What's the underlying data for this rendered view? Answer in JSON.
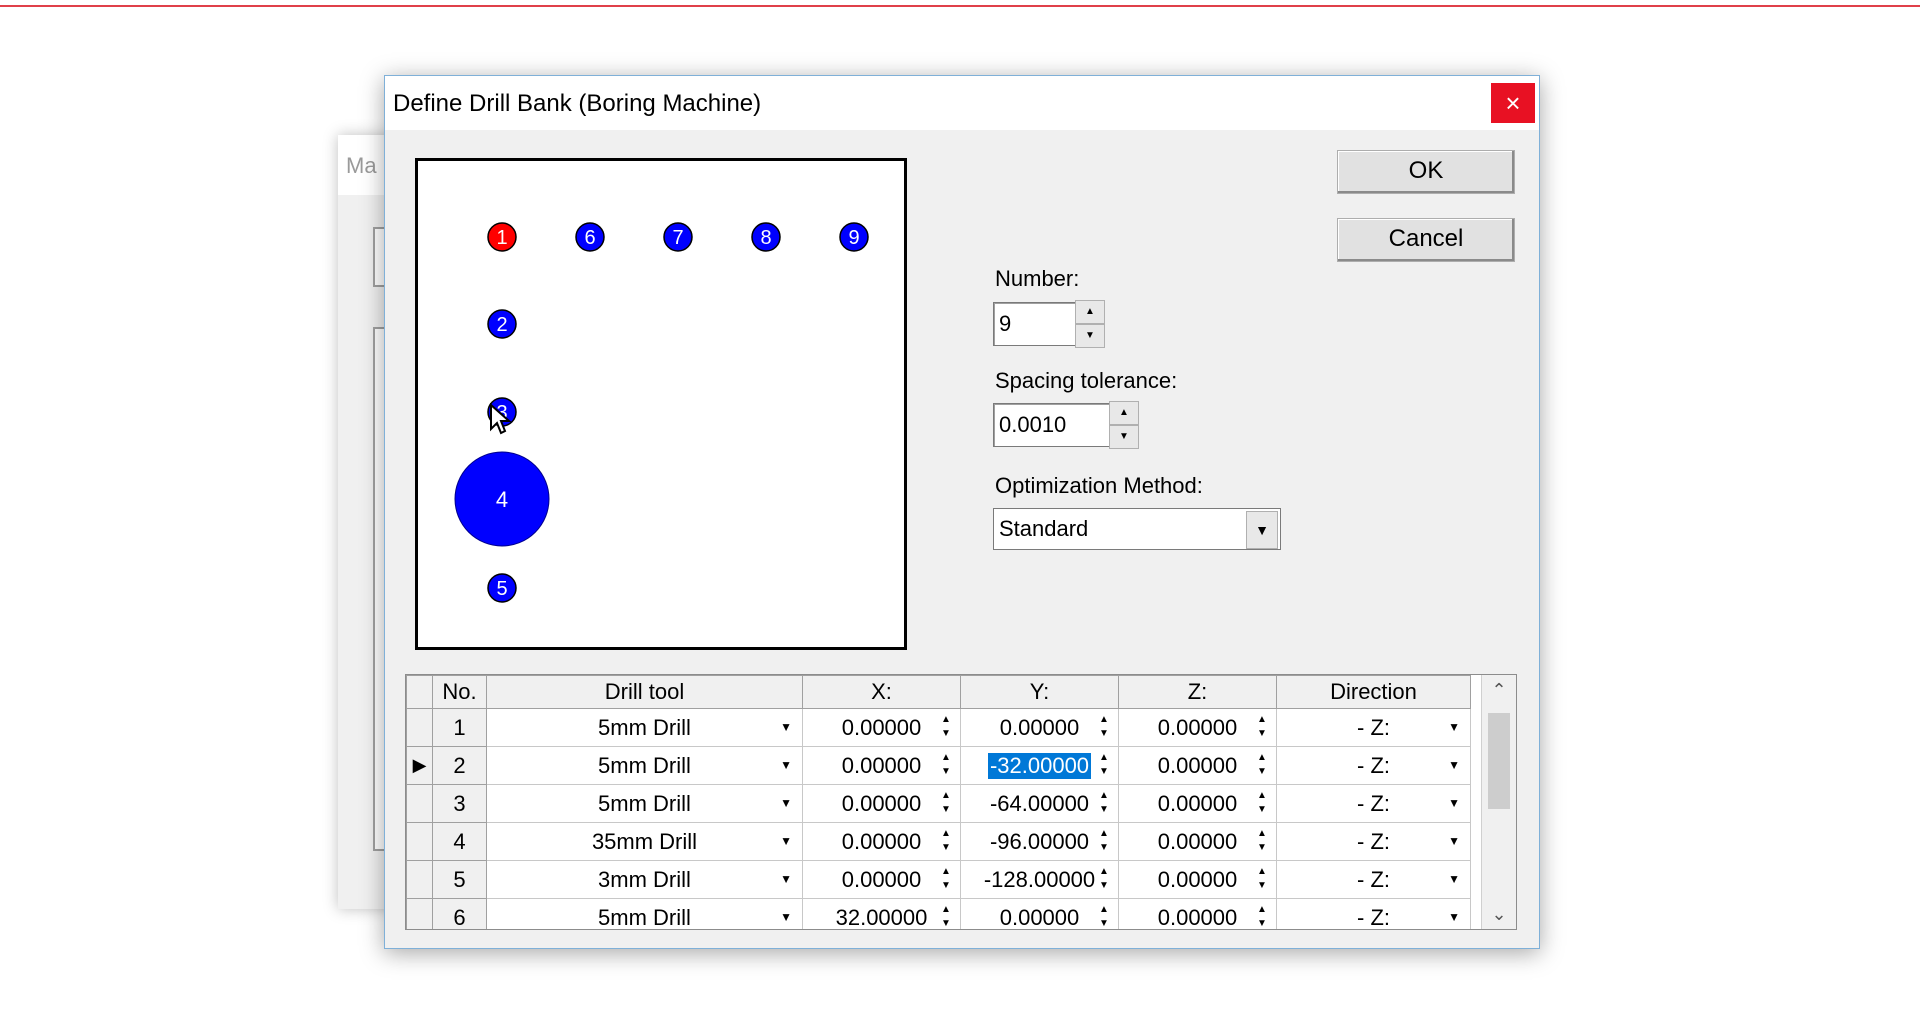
{
  "background_window": {
    "title": "Ma"
  },
  "dialog": {
    "title": "Define Drill Bank (Boring Machine)",
    "close_glyph": "×"
  },
  "buttons": {
    "ok": "OK",
    "cancel": "Cancel"
  },
  "fields": {
    "number_label": "Number:",
    "number_value": "9",
    "spacing_label": "Spacing tolerance:",
    "spacing_value": "0.0010",
    "optimization_label": "Optimization Method:",
    "optimization_value": "Standard"
  },
  "preview": {
    "holes": [
      {
        "label": "1",
        "color": "#ff0000",
        "size": "small"
      },
      {
        "label": "6",
        "color": "#0000ff",
        "size": "small"
      },
      {
        "label": "7",
        "color": "#0000ff",
        "size": "small"
      },
      {
        "label": "8",
        "color": "#0000ff",
        "size": "small"
      },
      {
        "label": "9",
        "color": "#0000ff",
        "size": "small"
      },
      {
        "label": "2",
        "color": "#0000ff",
        "size": "small"
      },
      {
        "label": "3",
        "color": "#0000ff",
        "size": "small"
      },
      {
        "label": "4",
        "color": "#0000ff",
        "size": "large"
      },
      {
        "label": "5",
        "color": "#0000ff",
        "size": "small"
      }
    ]
  },
  "grid": {
    "headers": [
      "",
      "No.",
      "Drill tool",
      "X:",
      "Y:",
      "Z:",
      "Direction"
    ],
    "current_row_marker": "▶",
    "rows": [
      {
        "no": "1",
        "tool": "5mm Drill",
        "x": "0.00000",
        "y": "0.00000",
        "z": "0.00000",
        "dir": "- Z:"
      },
      {
        "no": "2",
        "tool": "5mm Drill",
        "x": "0.00000",
        "y": "-32.00000",
        "z": "0.00000",
        "dir": "- Z:"
      },
      {
        "no": "3",
        "tool": "5mm Drill",
        "x": "0.00000",
        "y": "-64.00000",
        "z": "0.00000",
        "dir": "- Z:"
      },
      {
        "no": "4",
        "tool": "35mm Drill",
        "x": "0.00000",
        "y": "-96.00000",
        "z": "0.00000",
        "dir": "- Z:"
      },
      {
        "no": "5",
        "tool": "3mm Drill",
        "x": "0.00000",
        "y": "-128.00000",
        "z": "0.00000",
        "dir": "- Z:"
      },
      {
        "no": "6",
        "tool": "5mm Drill",
        "x": "32.00000",
        "y": "0.00000",
        "z": "0.00000",
        "dir": "- Z:"
      }
    ]
  }
}
